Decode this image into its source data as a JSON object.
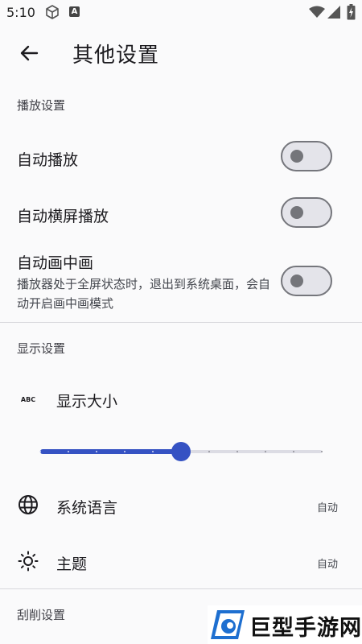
{
  "status_bar": {
    "time": "5:10",
    "icons": [
      "cube-icon",
      "a-icon",
      "wifi-icon",
      "signal-icon",
      "battery-icon"
    ],
    "a_label": "A"
  },
  "app_bar": {
    "back_icon": "arrow-left-icon",
    "title": "其他设置"
  },
  "playback": {
    "header": "播放设置",
    "items": [
      {
        "label": "自动播放",
        "enabled": false
      },
      {
        "label": "自动横屏播放",
        "enabled": false
      },
      {
        "label": "自动画中画",
        "subtitle": "播放器处于全屏状态时，退出到系统桌面，会自动开启画中画模式",
        "enabled": false
      }
    ]
  },
  "display": {
    "header": "显示设置",
    "size": {
      "icon": "abc-text-size-icon",
      "label": "显示大小",
      "abc_glyph": "ABC",
      "slider_fraction": 0.5,
      "ticks": 11
    },
    "language": {
      "icon": "globe-icon",
      "label": "系统语言",
      "value": "自动"
    },
    "theme": {
      "icon": "brightness-icon",
      "label": "主题",
      "value": "自动"
    }
  },
  "scrape": {
    "header": "刮削设置"
  },
  "watermark": {
    "text": "巨型手游网"
  },
  "colors": {
    "accent": "#3552c3",
    "background": "#fafafb",
    "switch_off_track": "#e4e4ea",
    "switch_off_border": "#75767c"
  }
}
